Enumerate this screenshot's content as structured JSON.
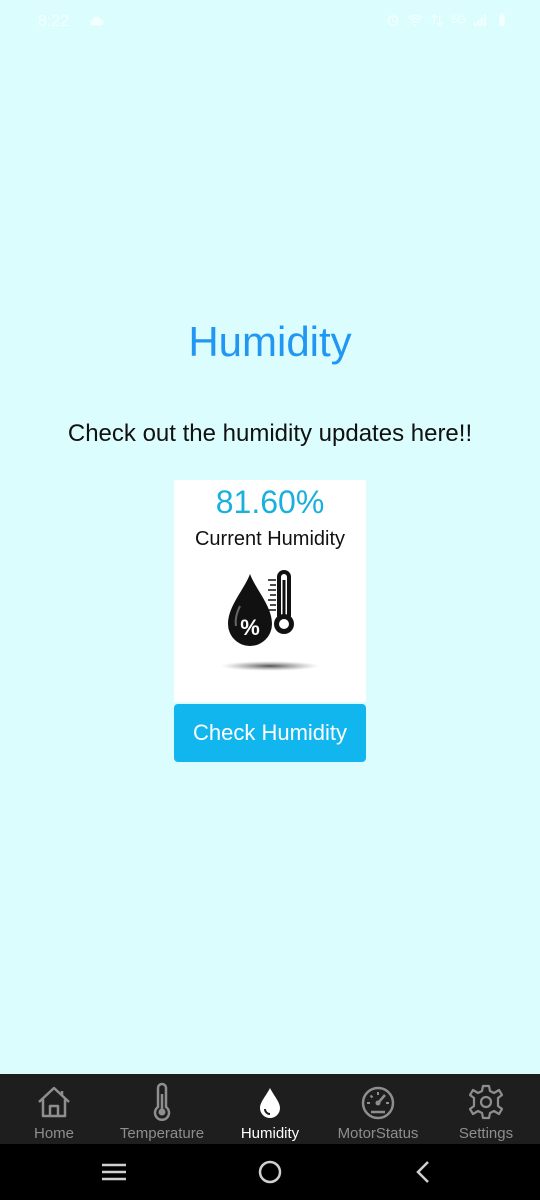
{
  "status_bar": {
    "time": "8:22",
    "network_text": "5G"
  },
  "main": {
    "title": "Humidity",
    "subtitle": "Check out the humidity updates here!!",
    "card": {
      "value": "81.60%",
      "label": "Current Humidity",
      "graphic_symbol": "%"
    },
    "button_label": "Check Humidity"
  },
  "bottom_nav": {
    "active": "Humidity",
    "items": [
      {
        "label": "Home",
        "icon": "home-icon"
      },
      {
        "label": "Temperature",
        "icon": "thermometer-icon"
      },
      {
        "label": "Humidity",
        "icon": "water-drop-icon"
      },
      {
        "label": "MotorStatus",
        "icon": "speedometer-icon"
      },
      {
        "label": "Settings",
        "icon": "gear-icon"
      }
    ]
  },
  "colors": {
    "background": "#dcfdfd",
    "title": "#2196f3",
    "value": "#1ab0dc",
    "button": "#12b6ef",
    "nav_background": "#1e1e1e",
    "nav_inactive": "#8e8e8e",
    "nav_active": "#ffffff"
  }
}
